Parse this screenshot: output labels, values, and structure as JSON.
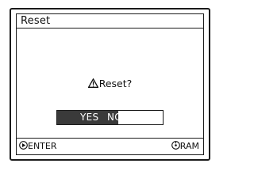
{
  "dialog": {
    "title": "Reset",
    "prompt": "Reset?",
    "warning_icon": "warning-icon",
    "options": {
      "yes_label": "YES",
      "no_label": "NO",
      "selected": "YES"
    }
  },
  "footer": {
    "enter_icon": "play-icon",
    "enter_label": "ENTER",
    "media_icon": "disc-icon",
    "media_label": "RAM"
  },
  "colors": {
    "border": "#1a1a1a",
    "highlight": "#3a3a3a",
    "background": "#ffffff"
  }
}
